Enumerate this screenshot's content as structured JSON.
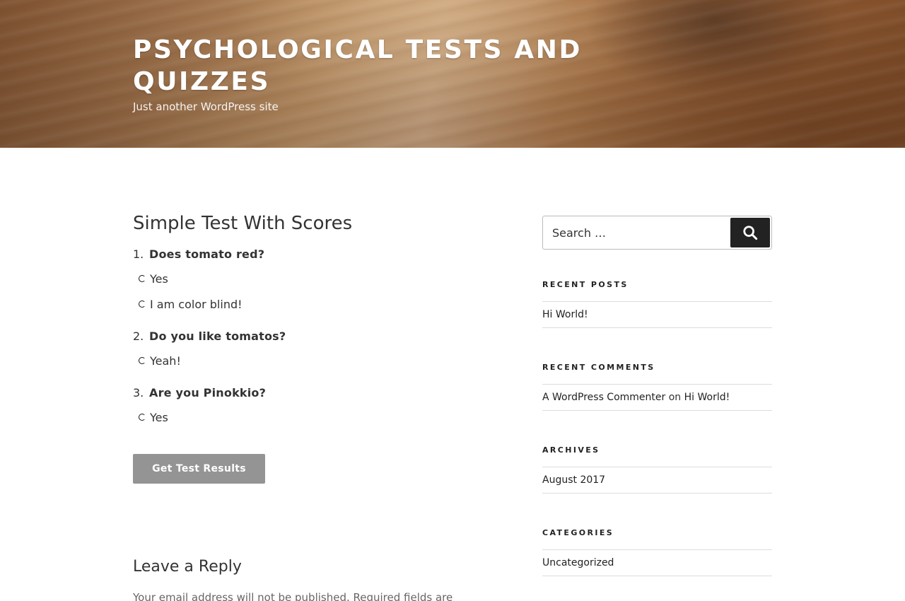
{
  "header": {
    "site_title": "Psychological tests and quizzes",
    "tagline": "Just another WordPress site"
  },
  "post": {
    "title": "Simple Test With Scores",
    "questions": [
      {
        "number": "1.",
        "text": "Does tomato red?",
        "answers": [
          "Yes",
          "I am color blind!"
        ]
      },
      {
        "number": "2.",
        "text": "Do you like tomatos?",
        "answers": [
          "Yeah!"
        ]
      },
      {
        "number": "3.",
        "text": "Are you Pinokkio?",
        "answers": [
          "Yes"
        ]
      }
    ],
    "submit_label": "Get Test Results"
  },
  "comments": {
    "title": "Leave a Reply",
    "notes": "Your email address will not be published. Required fields are"
  },
  "sidebar": {
    "search": {
      "placeholder": "Search …",
      "button_label": "Search",
      "icon": "search-icon"
    },
    "recent_posts": {
      "title": "Recent Posts",
      "items": [
        "Hi World!"
      ]
    },
    "recent_comments": {
      "title": "Recent Comments",
      "author": "A WordPress Commenter",
      "on": "on",
      "post": "Hi World!"
    },
    "archives": {
      "title": "Archives",
      "items": [
        "August 2017"
      ]
    },
    "categories": {
      "title": "Categories",
      "items": [
        "Uncategorized"
      ]
    }
  }
}
